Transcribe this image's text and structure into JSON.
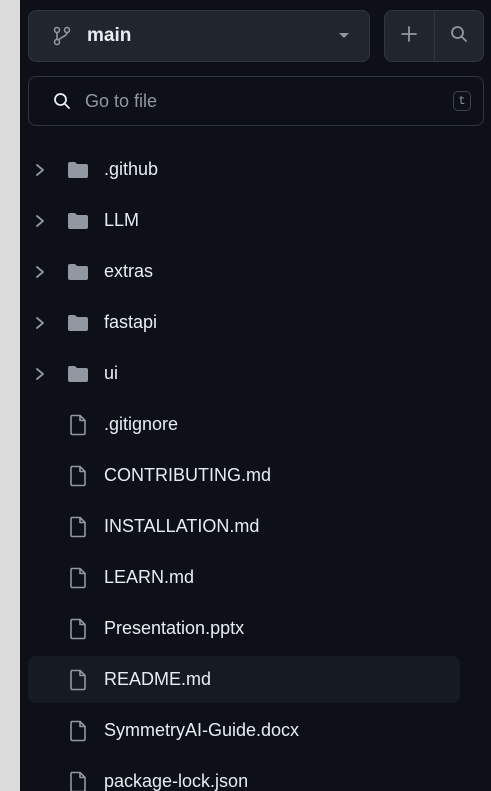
{
  "branch": {
    "name": "main",
    "icon": "git-branch-icon"
  },
  "actions": {
    "add_icon": "plus-icon",
    "search_icon": "search-icon"
  },
  "search": {
    "placeholder": "Go to file",
    "shortcut": "t"
  },
  "colors": {
    "background": "#0d1117",
    "button": "#21262d",
    "border": "#30363d",
    "text": "#e6edf3",
    "muted": "#9198a1",
    "selected_row": "#161b22"
  },
  "tree": {
    "folders": [
      {
        "name": ".github"
      },
      {
        "name": "LLM"
      },
      {
        "name": "extras"
      },
      {
        "name": "fastapi"
      },
      {
        "name": "ui"
      }
    ],
    "files": [
      {
        "name": ".gitignore"
      },
      {
        "name": "CONTRIBUTING.md"
      },
      {
        "name": "INSTALLATION.md"
      },
      {
        "name": "LEARN.md"
      },
      {
        "name": "Presentation.pptx"
      },
      {
        "name": "README.md",
        "selected": true
      },
      {
        "name": "SymmetryAI-Guide.docx"
      },
      {
        "name": "package-lock.json"
      }
    ]
  }
}
